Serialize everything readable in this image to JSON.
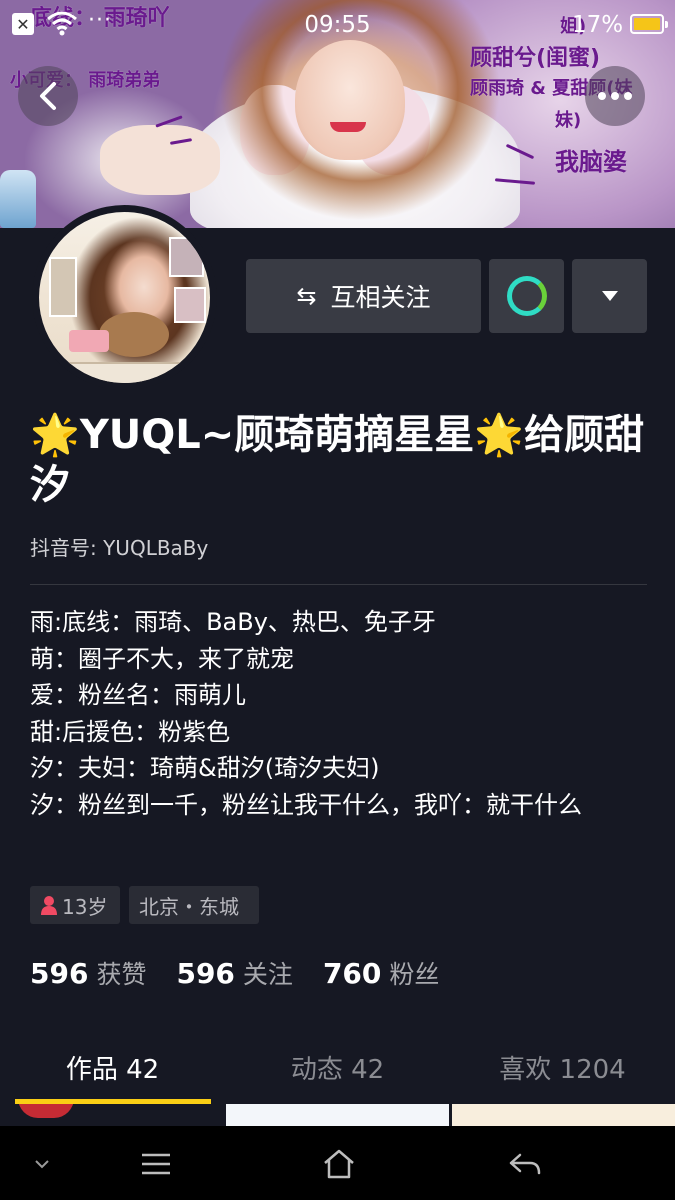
{
  "status_bar": {
    "time": "09:55",
    "battery_percent": "17%",
    "notification_dots": "···"
  },
  "banner": {
    "scrawl_top_left": "底线：  雨琦吖",
    "scrawl_left": "小可爱：  雨琦弟弟",
    "scrawl_top_right_partial": "姐)",
    "scrawl_right_1": "顾甜兮(闺蜜)",
    "scrawl_right_2": "顾雨琦 & 夏甜顾(妹",
    "scrawl_right_3": "妹)",
    "scrawl_right_4": "我脑婆"
  },
  "actions": {
    "follow_label": "互相关注",
    "follow_icon": "swap-arrows",
    "chat_icon": "chat-bubble",
    "dropdown_icon": "triangle-down"
  },
  "profile": {
    "nickname_part1": "YUQL~顾琦萌摘星星",
    "nickname_part2": "给顾甜汐",
    "nickname_emoji": "🌟",
    "douyin_id": "抖音号: YUQLBaBy",
    "bio": [
      "雨:底线：雨琦、BaBy、热巴、免子牙",
      "萌：圈子不大，来了就宠",
      "爱：粉丝名：雨萌儿",
      "甜:后援色：粉紫色",
      "汐：夫妇：琦萌&甜汐(琦汐夫妇)",
      "汐：粉丝到一千，粉丝让我干什么，我吖：就干什么"
    ],
    "age_tag": "13岁",
    "location_tag": "北京・东城"
  },
  "stats": [
    {
      "value": "596",
      "label": "获赞"
    },
    {
      "value": "596",
      "label": "关注"
    },
    {
      "value": "760",
      "label": "粉丝"
    }
  ],
  "tabs": [
    {
      "label": "作品 42",
      "active": true
    },
    {
      "label": "动态 42",
      "active": false
    },
    {
      "label": "喜欢 1204",
      "active": false
    }
  ],
  "colors": {
    "background": "#161823",
    "button": "#393b44",
    "tab_indicator": "#face15",
    "female_icon": "#f04a63",
    "chat_ring": "#2fdcc5"
  }
}
